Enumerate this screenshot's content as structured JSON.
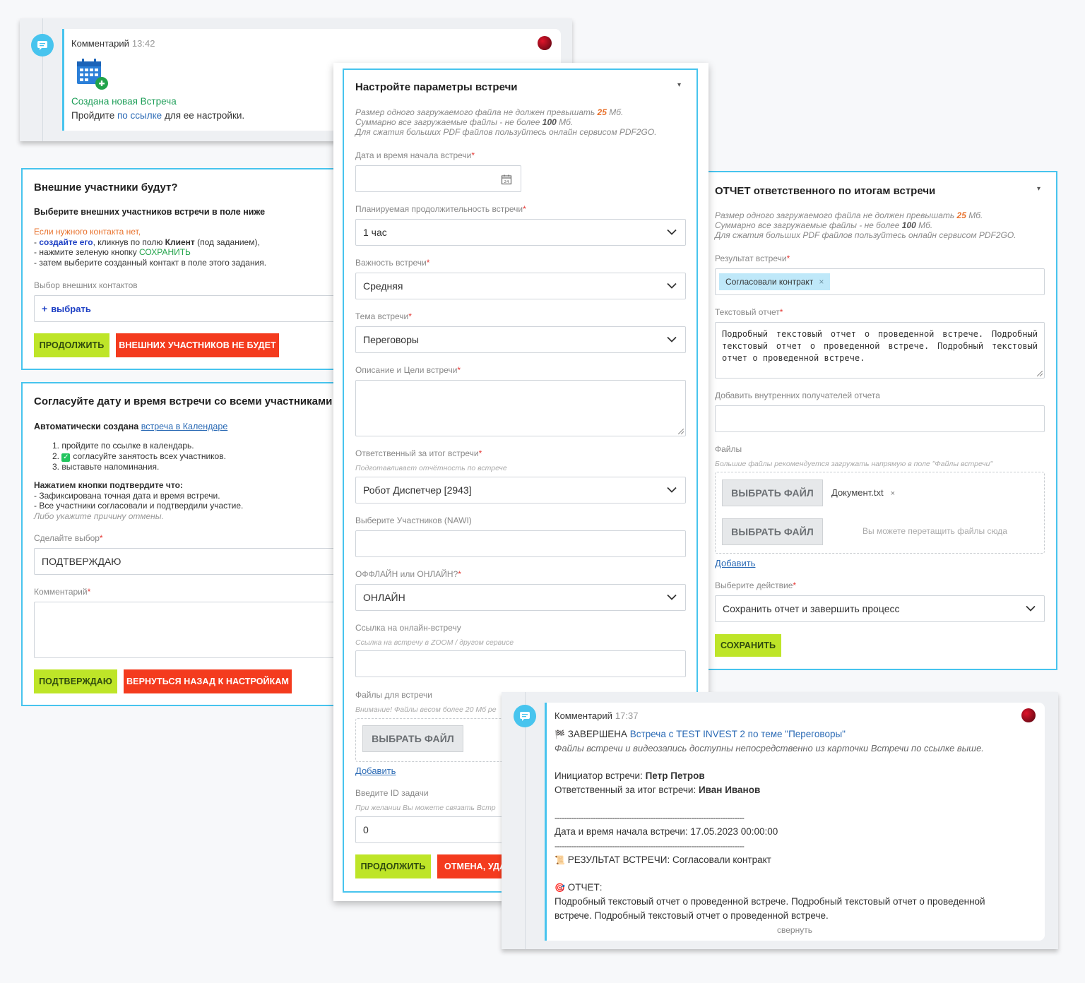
{
  "colors": {
    "accent": "#47c4ee",
    "green": "#bee528",
    "red": "#f43b1e",
    "link": "#2a6ab5"
  },
  "comment1": {
    "author": "Комментарий",
    "time": "13:42",
    "title": "Создана новая Встреча",
    "text_before": "Пройдите ",
    "link": "по ссылке",
    "text_after": " для ее настройки."
  },
  "external": {
    "title": "Внешние участники будут?",
    "subtitle": "Выберите внешних участников встречи в поле ниже",
    "warn": "Если нужного контакта нет,",
    "line1_pre": "- ",
    "line1_link": "создайте его",
    "line1_mid": ", кликнув по полю ",
    "line1_bold": "Клиент",
    "line1_post": " (под заданием),",
    "line2_pre": "- нажмите зеленую кнопку ",
    "line2_green": "СОХРАНИТЬ",
    "line3": "- затем выберите созданный контакт в поле этого задания.",
    "field_label": "Выбор внешних контактов",
    "select_text": "выбрать",
    "btn_continue": "Продолжить",
    "btn_none": "Внешних участников не будет"
  },
  "agree": {
    "title": "Согласуйте дату и время встречи со всеми участниками",
    "auto_pre": "Автоматически создана ",
    "auto_link": "встреча в Календаре",
    "steps": [
      "пройдите по ссылке в календарь.",
      "согласуйте занятость всех участников.",
      "выставьте напоминания."
    ],
    "confirm_title": "Нажатием кнопки подтвердите что:",
    "confirm_1": "- Зафиксирована точная дата и время встречи.",
    "confirm_2": "- Все участники согласовали и подтвердили участие.",
    "confirm_3": "Либо укажите причину отмены.",
    "choice_label": "Сделайте выбор",
    "choice_value": "ПОДТВЕРЖДАЮ",
    "comment_label": "Комментарий",
    "btn_confirm": "Подтверждаю",
    "btn_back": "Вернуться назад к настройкам"
  },
  "setup": {
    "title": "Настройте параметры встречи",
    "note1_pre": "Размер одного загружаемого файла не должен превышать ",
    "note1_val": "25",
    "note1_unit": " Мб.",
    "note2_pre": "Суммарно все загружаемые файлы - не более ",
    "note2_val": "100",
    "note2_unit": " Мб.",
    "note3": "Для сжатия больших PDF файлов пользуйтесь онлайн сервисом PDF2GO.",
    "date_label": "Дата и время начала встречи",
    "duration_label": "Планируемая продолжительность встречи",
    "duration_value": "1 час",
    "importance_label": "Важность встречи",
    "importance_value": "Средняя",
    "topic_label": "Тема встречи",
    "topic_value": "Переговоры",
    "desc_label": "Описание и Цели встречи",
    "resp_label": "Ответственный за итог встречи",
    "resp_hint": "Подготавливает отчётность по встрече",
    "resp_value": "Робот Диспетчер [2943]",
    "participants_label": "Выберите Участников (NAWI)",
    "mode_label": "ОФФЛАЙН или ОНЛАЙН?",
    "mode_value": "ОНЛАЙН",
    "link_label": "Ссылка на онлайн-встречу",
    "link_hint": "Ссылка на встречу в ZOOM / другом сервисе",
    "files_label": "Файлы для встречи",
    "files_hint": "Внимание! Файлы весом более 20 Мб ре",
    "file_btn": "Выбрать файл",
    "add_link": "Добавить",
    "task_label": "Введите ID задачи",
    "task_hint": "При желании Вы можете связать Встр",
    "task_value": "0",
    "btn_continue": "Продолжить",
    "btn_cancel": "Отмена, уда"
  },
  "report": {
    "title": "ОТЧЕТ ответственного по итогам встречи",
    "note1_pre": "Размер одного загружаемого файла не должен превышать ",
    "note1_val": "25",
    "note1_unit": " Мб.",
    "note2_pre": "Суммарно все загружаемые файлы - не более ",
    "note2_val": "100",
    "note2_unit": " Мб.",
    "note3": "Для сжатия больших PDF файлов пользуйтесь онлайн сервисом PDF2GO.",
    "result_label": "Результат встречи",
    "result_chip": "Согласовали контракт",
    "text_label": "Текстовый отчет",
    "text_value": "Подробный текстовый отчет о проведенной встрече. Подробный текстовый отчет о проведенной встрече. Подробный текстовый отчет о проведенной встрече.",
    "recipients_label": "Добавить внутренних получателей отчета",
    "files_label": "Файлы",
    "files_hint": "Большие файлы рекомендуется загружать напрямую в поле \"Файлы встречи\"",
    "file_btn": "Выбрать файл",
    "file_name": "Документ.txt",
    "drop_hint": "Вы можете перетащить файлы сюда",
    "add_link": "Добавить",
    "action_label": "Выберите действие",
    "action_value": "Сохранить отчет и завершить процесс",
    "btn_save": "Сохранить"
  },
  "comment2": {
    "author": "Комментарий",
    "time": "17:37",
    "status": "ЗАВЕРШЕНА",
    "meeting_link": "Встреча с TEST INVEST 2 по теме \"Переговоры\"",
    "italic": "Файлы встречи и видеозапись доступны непосредственно из карточки Встречи по ссылке выше.",
    "initiator_label": "Инициатор встречи: ",
    "initiator": "Петр Петров",
    "resp_label": "Ответственный за итог встречи: ",
    "resp": "Иван Иванов",
    "divider": "-------------------------------------------------------------------------------",
    "date_label": "Дата и время начала встречи: ",
    "date": "17.05.2023 00:00:00",
    "result": "РЕЗУЛЬТАТ ВСТРЕЧИ: Согласовали контракт",
    "report_label": "ОТЧЕТ:",
    "report_text": "Подробный текстовый отчет о проведенной встрече. Подробный текстовый отчет о проведенной встрече. Подробный текстовый отчет о проведенной встрече.",
    "collapse": "свернуть"
  }
}
